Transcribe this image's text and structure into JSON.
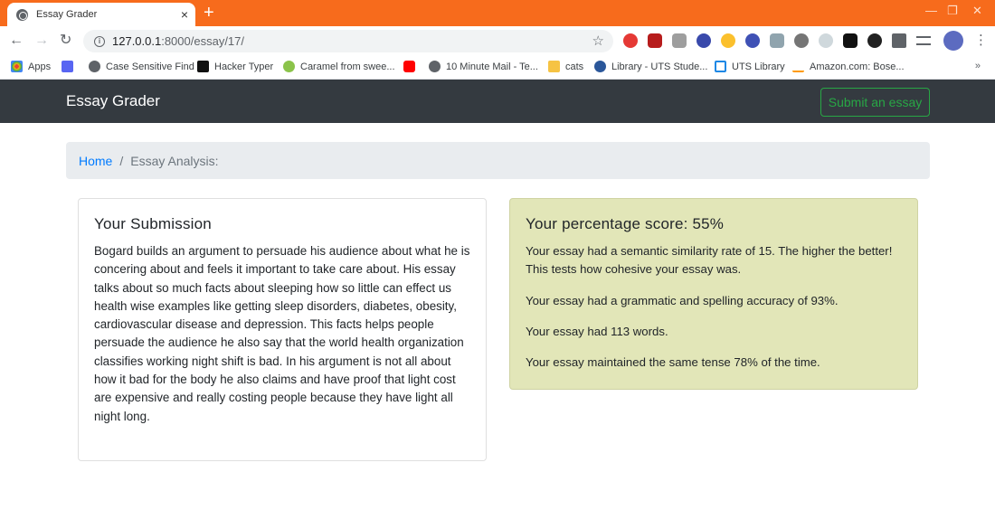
{
  "browser": {
    "tab_title": "Essay Grader",
    "tab_close": "×",
    "new_tab": "+",
    "url_host": "127.0.0.1",
    "url_path": ":8000/essay/17/",
    "bookmarks": [
      {
        "label": "Apps",
        "color": "#e8453c"
      },
      {
        "label": "",
        "color": "#5865f2"
      },
      {
        "label": "Case Sensitive Find",
        "color": "#5f6368"
      },
      {
        "label": "Hacker Typer",
        "color": "#111111"
      },
      {
        "label": "Caramel from swee...",
        "color": "#8bc34a"
      },
      {
        "label": "",
        "color": "#ff0000"
      },
      {
        "label": "10 Minute Mail - Te...",
        "color": "#5f6368"
      },
      {
        "label": "cats",
        "color": "#f6c343"
      },
      {
        "label": "Library - UTS Stude...",
        "color": "#2b579a"
      },
      {
        "label": "UTS Library",
        "color": "#1e88e5"
      },
      {
        "label": "Amazon.com: Bose...",
        "color": "#000000"
      }
    ],
    "bookmarks_more": "»",
    "colors": {
      "tabstrip": "#f76b1c"
    }
  },
  "navbar": {
    "brand": "Essay Grader",
    "submit_label": "Submit an essay"
  },
  "breadcrumb": {
    "home": "Home",
    "separator": "/",
    "current": "Essay Analysis:"
  },
  "submission": {
    "title": "Your Submission",
    "text": "Bogard builds an argument to persuade his audience about what he is concering about and feels it important to take care about. His essay talks about so much facts about sleeping how so little can effect us health wise examples like getting sleep disorders, diabetes, obesity, cardiovascular disease and depression. This facts helps people persuade the audience he also say that the world health organization classifies working night shift is bad. In his argument is not all about how it bad for the body he also claims and have proof that light cost are expensive and really costing people because they have light all night long."
  },
  "score": {
    "title": "Your percentage score: 55%",
    "lines": [
      "Your essay had a semantic similarity rate of 15. The higher the better! This tests how cohesive your essay was.",
      "Your essay had a grammatic and spelling accuracy of 93%.",
      "Your essay had 113 words.",
      "Your essay maintained the same tense 78% of the time."
    ],
    "colors": {
      "background": "#e2e6b8",
      "accent": "#28a745"
    }
  }
}
